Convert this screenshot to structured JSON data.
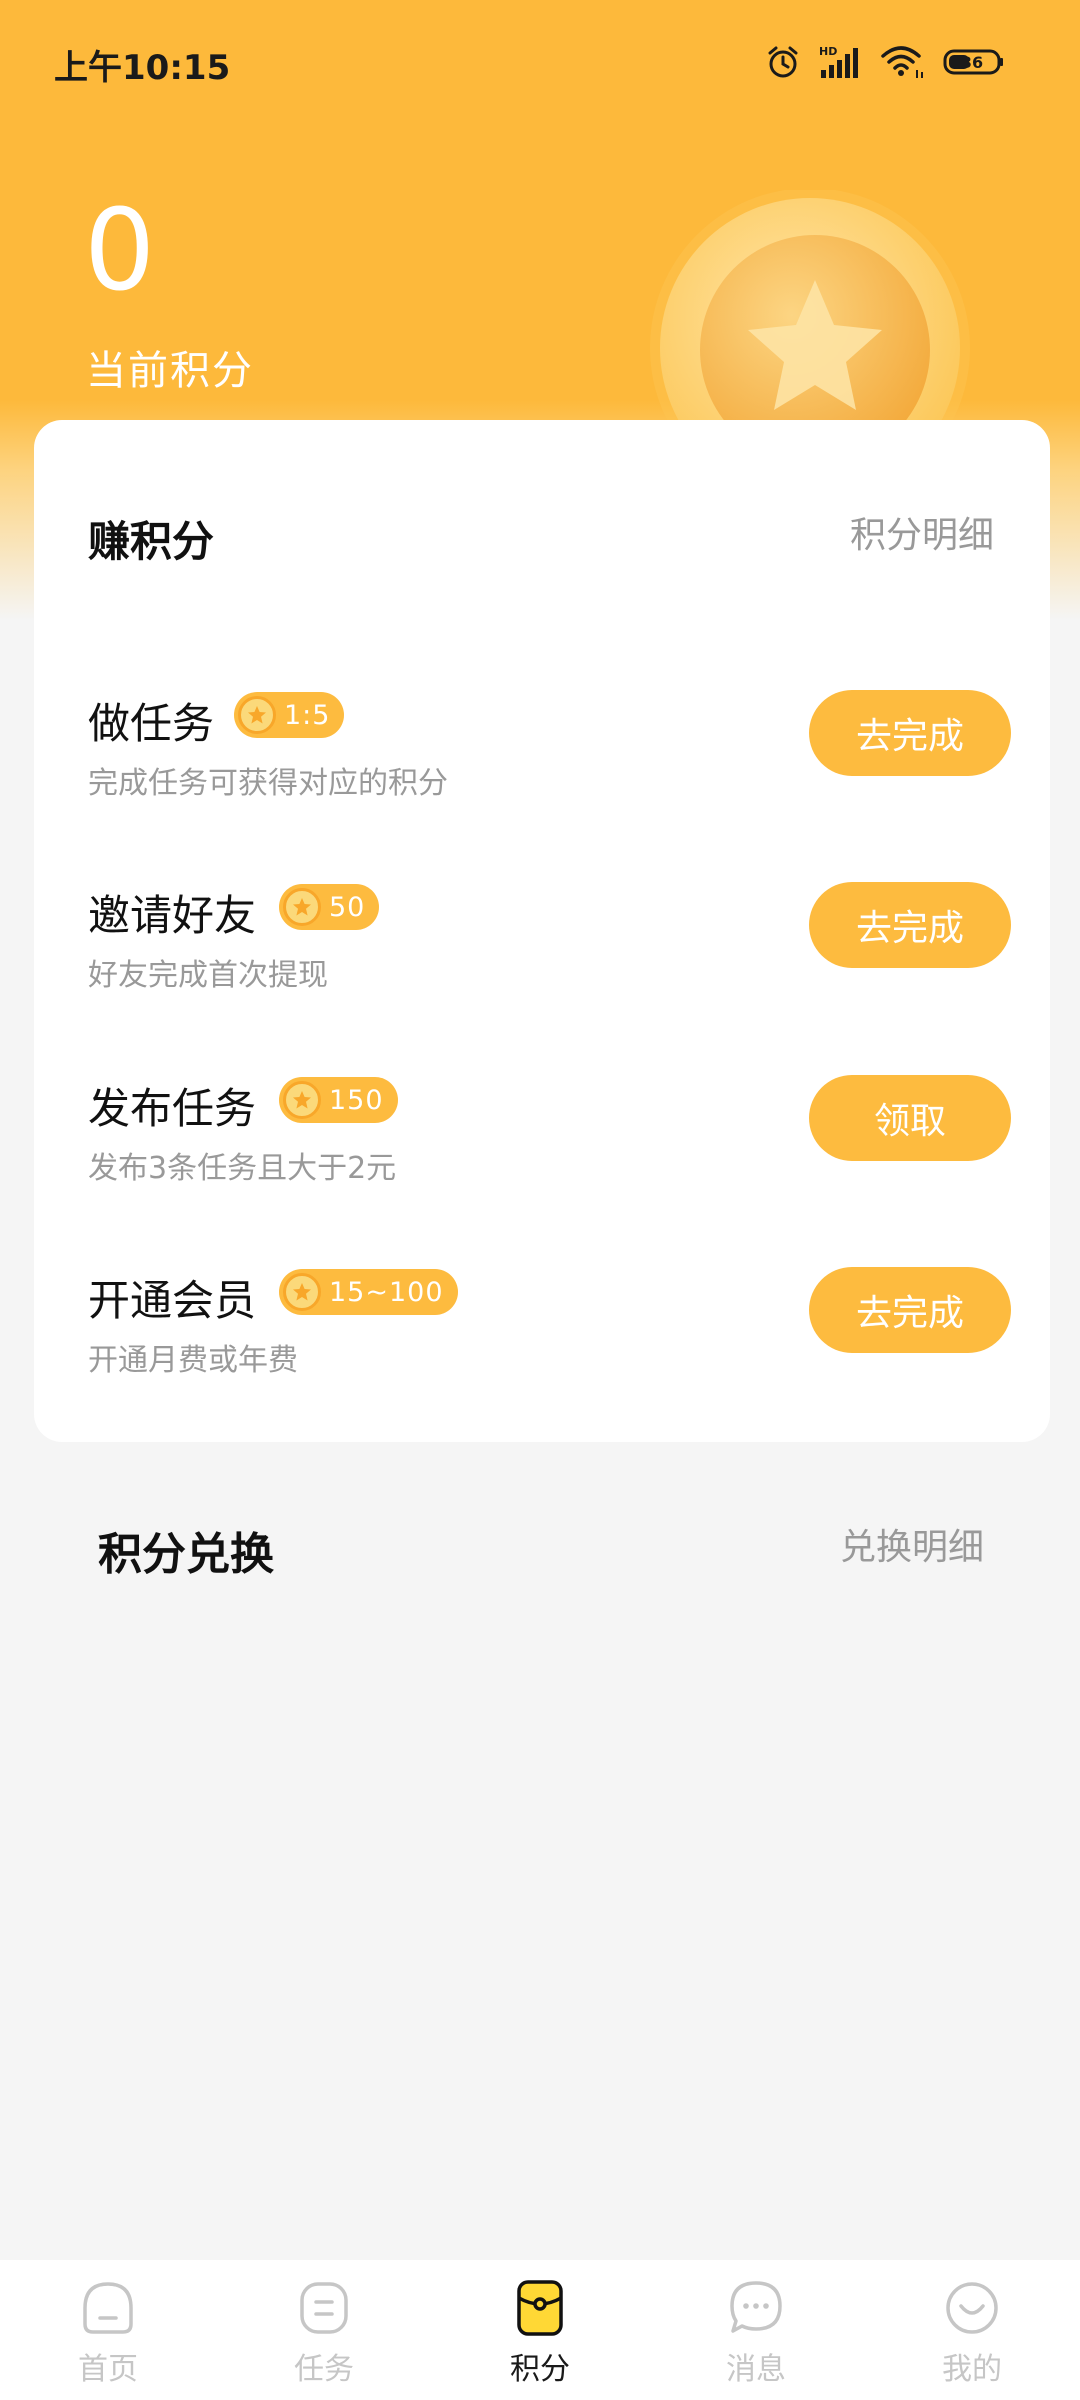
{
  "status_bar": {
    "time": "上午10:15",
    "battery": "36",
    "network": "HD"
  },
  "points": {
    "value": "0",
    "label": "当前积分"
  },
  "earn_section": {
    "title": "赚积分",
    "detail_link": "积分明细",
    "tasks": [
      {
        "name": "做任务",
        "badge": "1:5",
        "desc": "完成任务可获得对应的积分",
        "button": "去完成"
      },
      {
        "name": "邀请好友",
        "badge": "50",
        "desc": "好友完成首次提现",
        "button": "去完成"
      },
      {
        "name": "发布任务",
        "badge": "150",
        "desc": "发布3条任务且大于2元",
        "button": "领取"
      },
      {
        "name": "开通会员",
        "badge": "15~100",
        "desc": "开通月费或年费",
        "button": "去完成"
      }
    ]
  },
  "exchange_section": {
    "title": "积分兑换",
    "detail_link": "兑换明细"
  },
  "bottom_nav": {
    "items": [
      {
        "label": "首页",
        "icon": "home-icon",
        "active": false
      },
      {
        "label": "任务",
        "icon": "task-icon",
        "active": false
      },
      {
        "label": "积分",
        "icon": "points-wallet-icon",
        "active": true
      },
      {
        "label": "消息",
        "icon": "message-icon",
        "active": false
      },
      {
        "label": "我的",
        "icon": "profile-icon",
        "active": false
      }
    ]
  },
  "colors": {
    "accent": "#fdbb3f",
    "header": "#fdb93b",
    "background": "#f5f5f5"
  }
}
